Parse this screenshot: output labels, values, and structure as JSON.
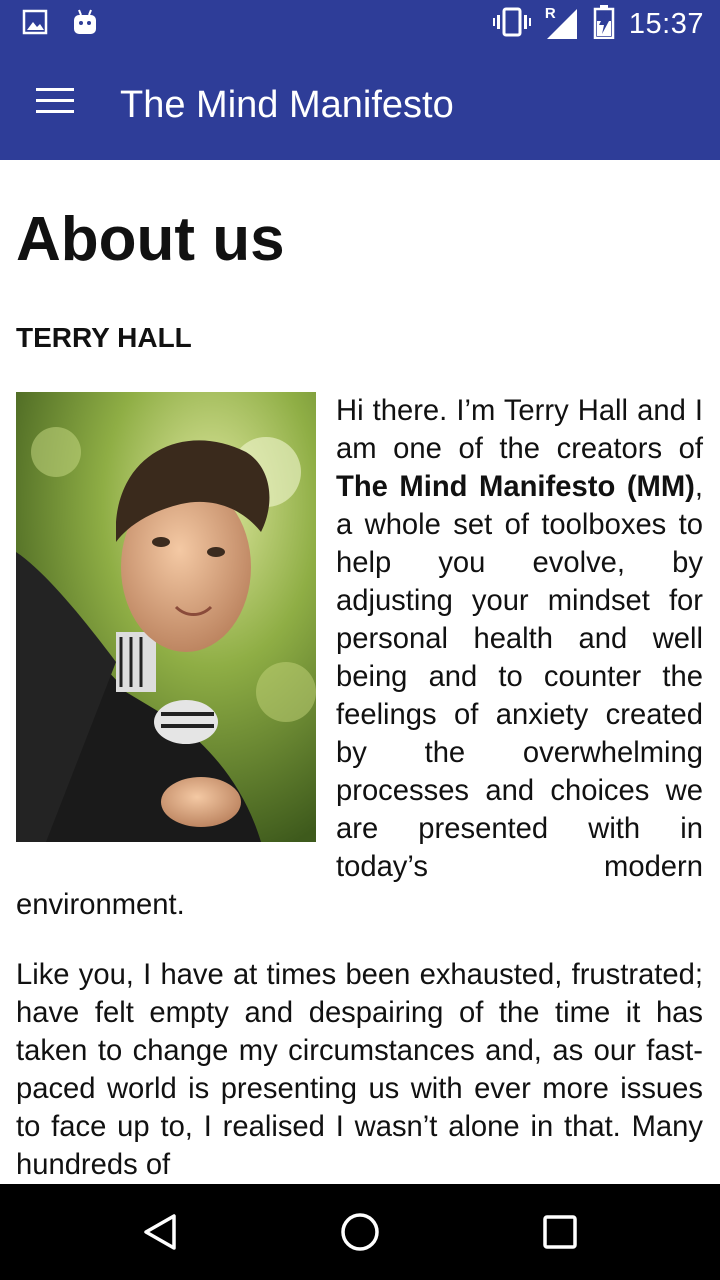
{
  "status_bar": {
    "time": "15:37",
    "network_label": "R",
    "icons": [
      "image-notification-icon",
      "android-notification-icon",
      "vibrate-icon",
      "signal-icon",
      "battery-charging-icon"
    ]
  },
  "app_bar": {
    "title": "The Mind Manifesto",
    "menu_icon": "hamburger-menu-icon"
  },
  "page": {
    "title": "About us",
    "author": "TERRY HALL",
    "photo_alt": "Portrait of Terry Hall",
    "intro": {
      "before": "Hi there. I’m Terry Hall and I am one of the creators of ",
      "bold": "The Mind Manifesto (MM)",
      "after": ", a whole set of toolboxes to help you evolve, by adjusting your mindset for personal health and well being and to counter the feelings of anxiety created by the overwhelming processes and choices we are presented with in today’s modern environment."
    },
    "paragraph2": "Like you, I have at times been exhausted, frustrated; have felt empty and despairing of the time it has taken to change my circumstances and, as our fast-paced world is presenting us with ever more issues to face up to, I realised I wasn’t alone in that. Many hundreds of"
  },
  "nav_bar": {
    "buttons": [
      "back-icon",
      "home-icon",
      "recents-icon"
    ]
  },
  "colors": {
    "primary": "#2E3D98",
    "text": "#111111",
    "nav_background": "#000000"
  }
}
